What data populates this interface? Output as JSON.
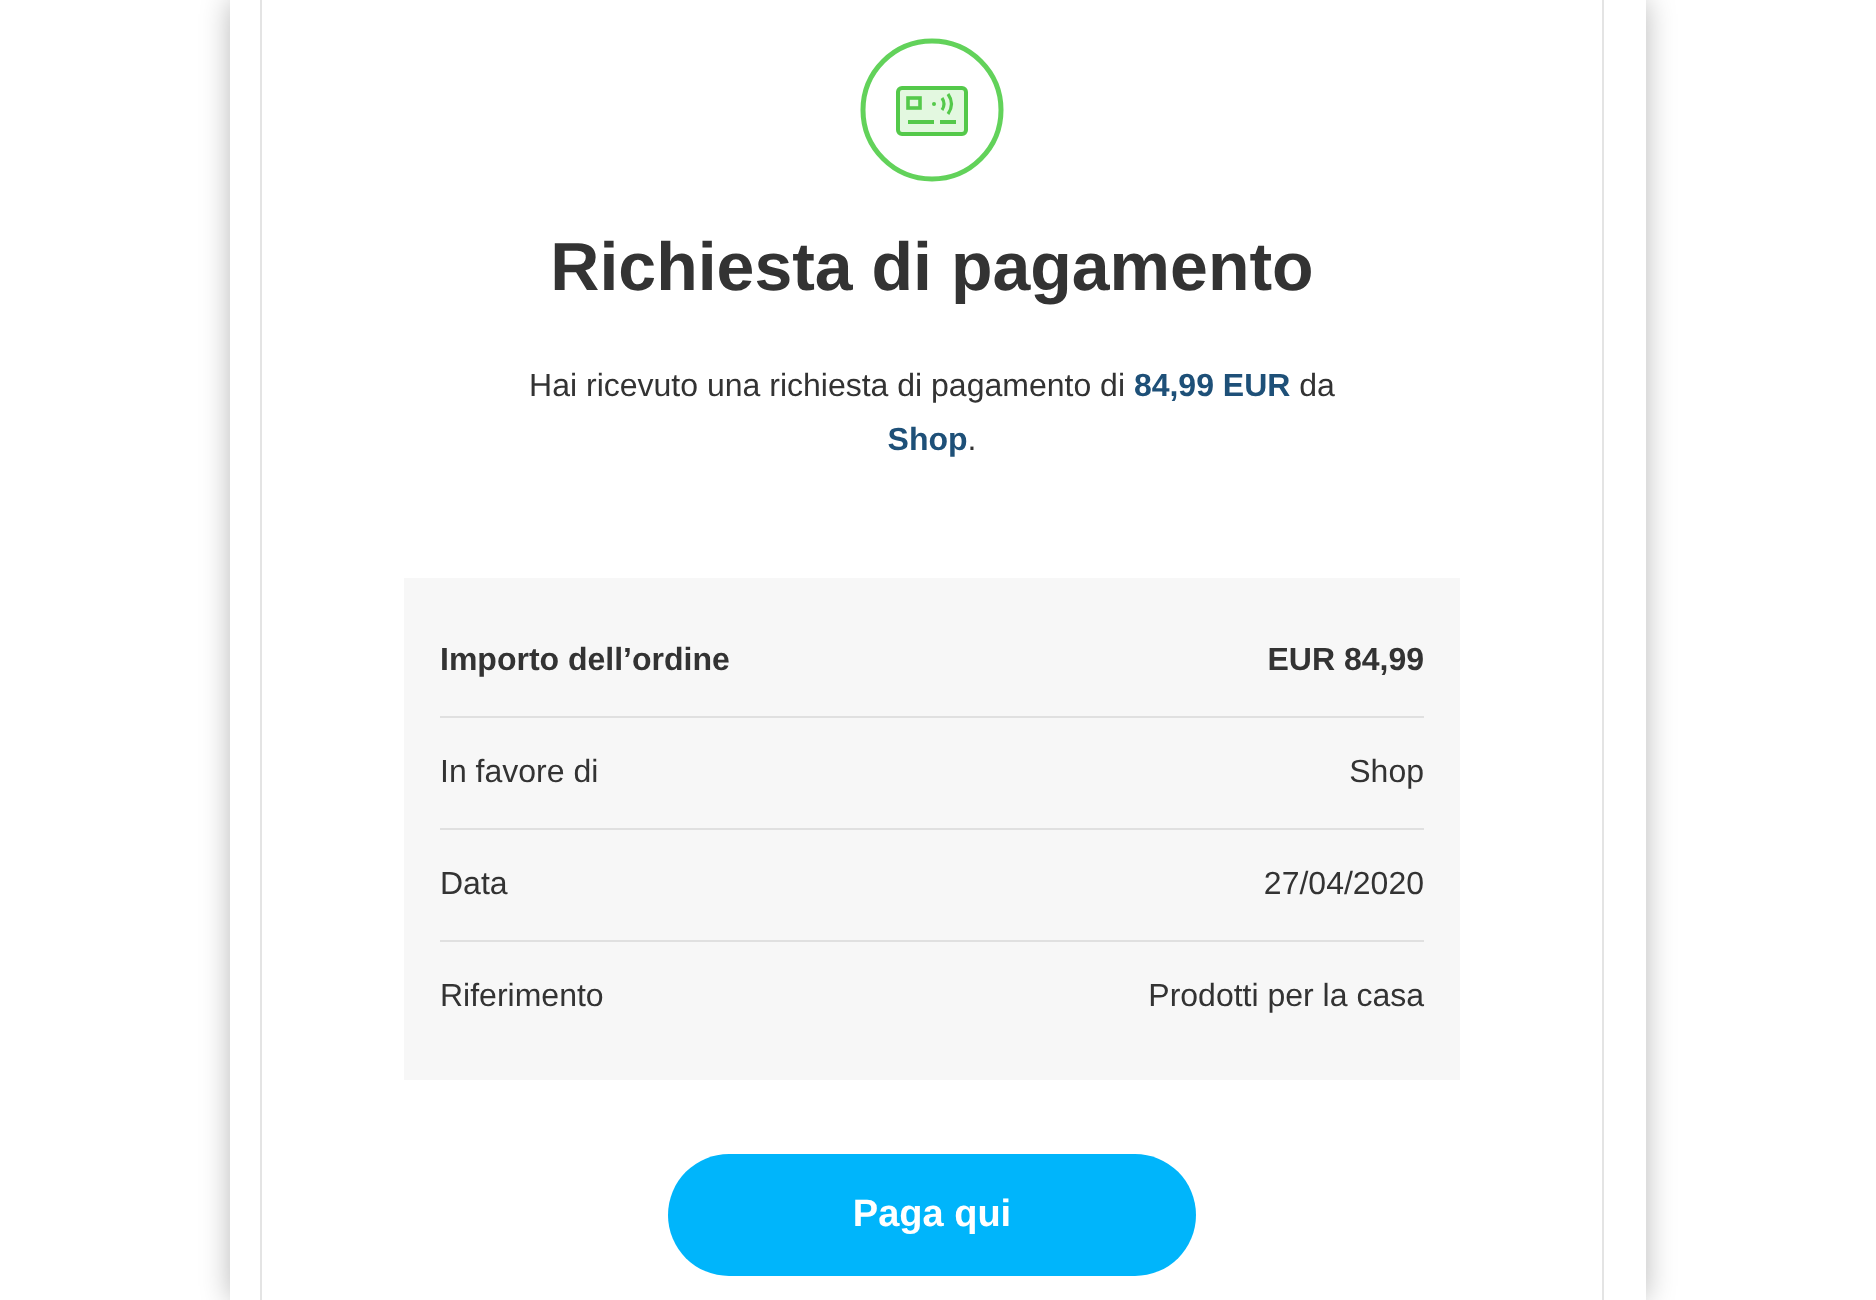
{
  "title": "Richiesta di pagamento",
  "message": "Hai ricevuto una richiesta di pagamento di **84,99 EUR** da **Shop**.",
  "details": [
    {
      "kind": "total",
      "label": "Importo dell’ordine",
      "value": "EUR 84,99"
    },
    {
      "kind": "detail",
      "label": "In favore di",
      "value": "Shop"
    },
    {
      "kind": "detail",
      "label": "Data",
      "value": "27/04/2020"
    },
    {
      "kind": "detail",
      "label": "Riferimento",
      "value": "Prodotti per la casa"
    }
  ],
  "button": "Paga qui"
}
